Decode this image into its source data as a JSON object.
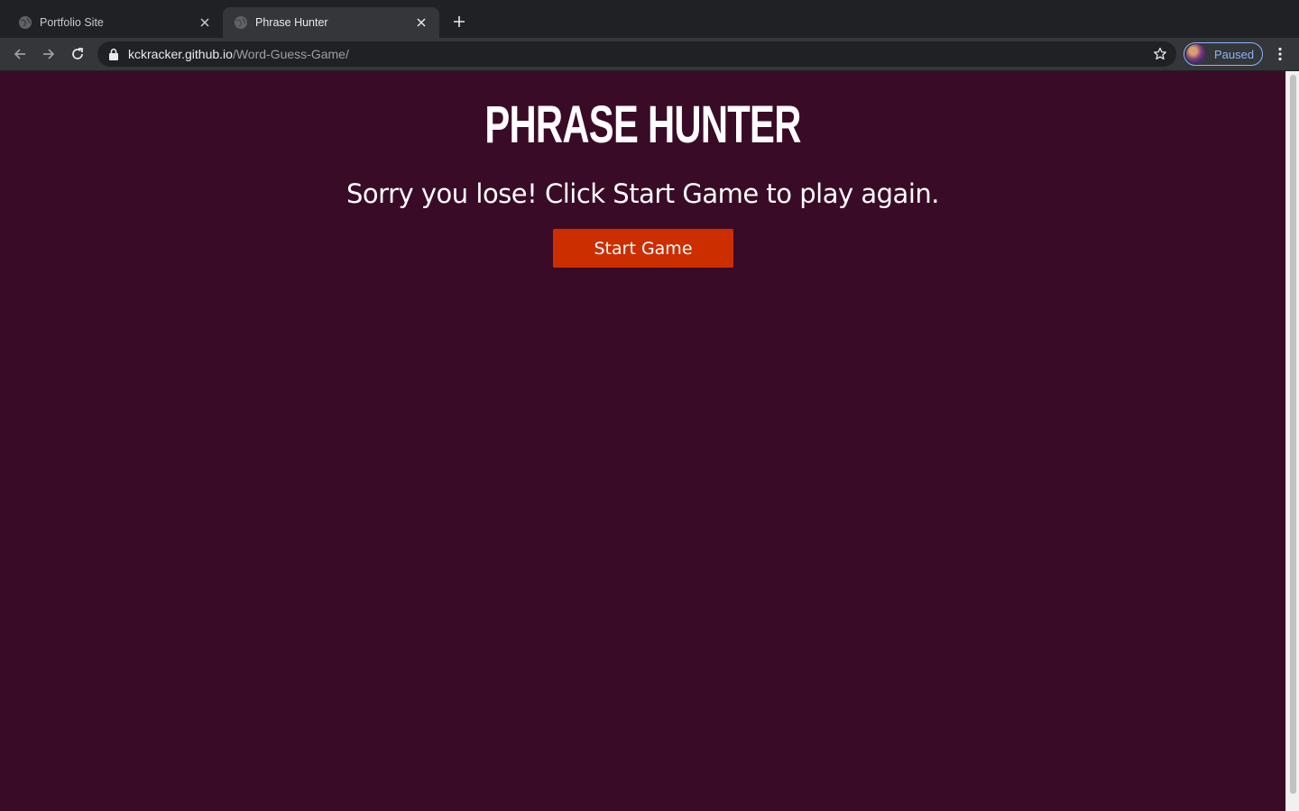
{
  "browser": {
    "tabs": [
      {
        "title": "Portfolio Site",
        "active": false
      },
      {
        "title": "Phrase Hunter",
        "active": true
      }
    ],
    "address": {
      "host": "kckracker.github.io",
      "path": "/Word-Guess-Game/"
    },
    "profile_label": "Paused"
  },
  "page": {
    "title": "PHRASE HUNTER",
    "message": "Sorry you lose! Click Start Game to play again.",
    "start_button": "Start Game",
    "background_color": "#3a0b27",
    "button_color": "#cc2e00"
  }
}
